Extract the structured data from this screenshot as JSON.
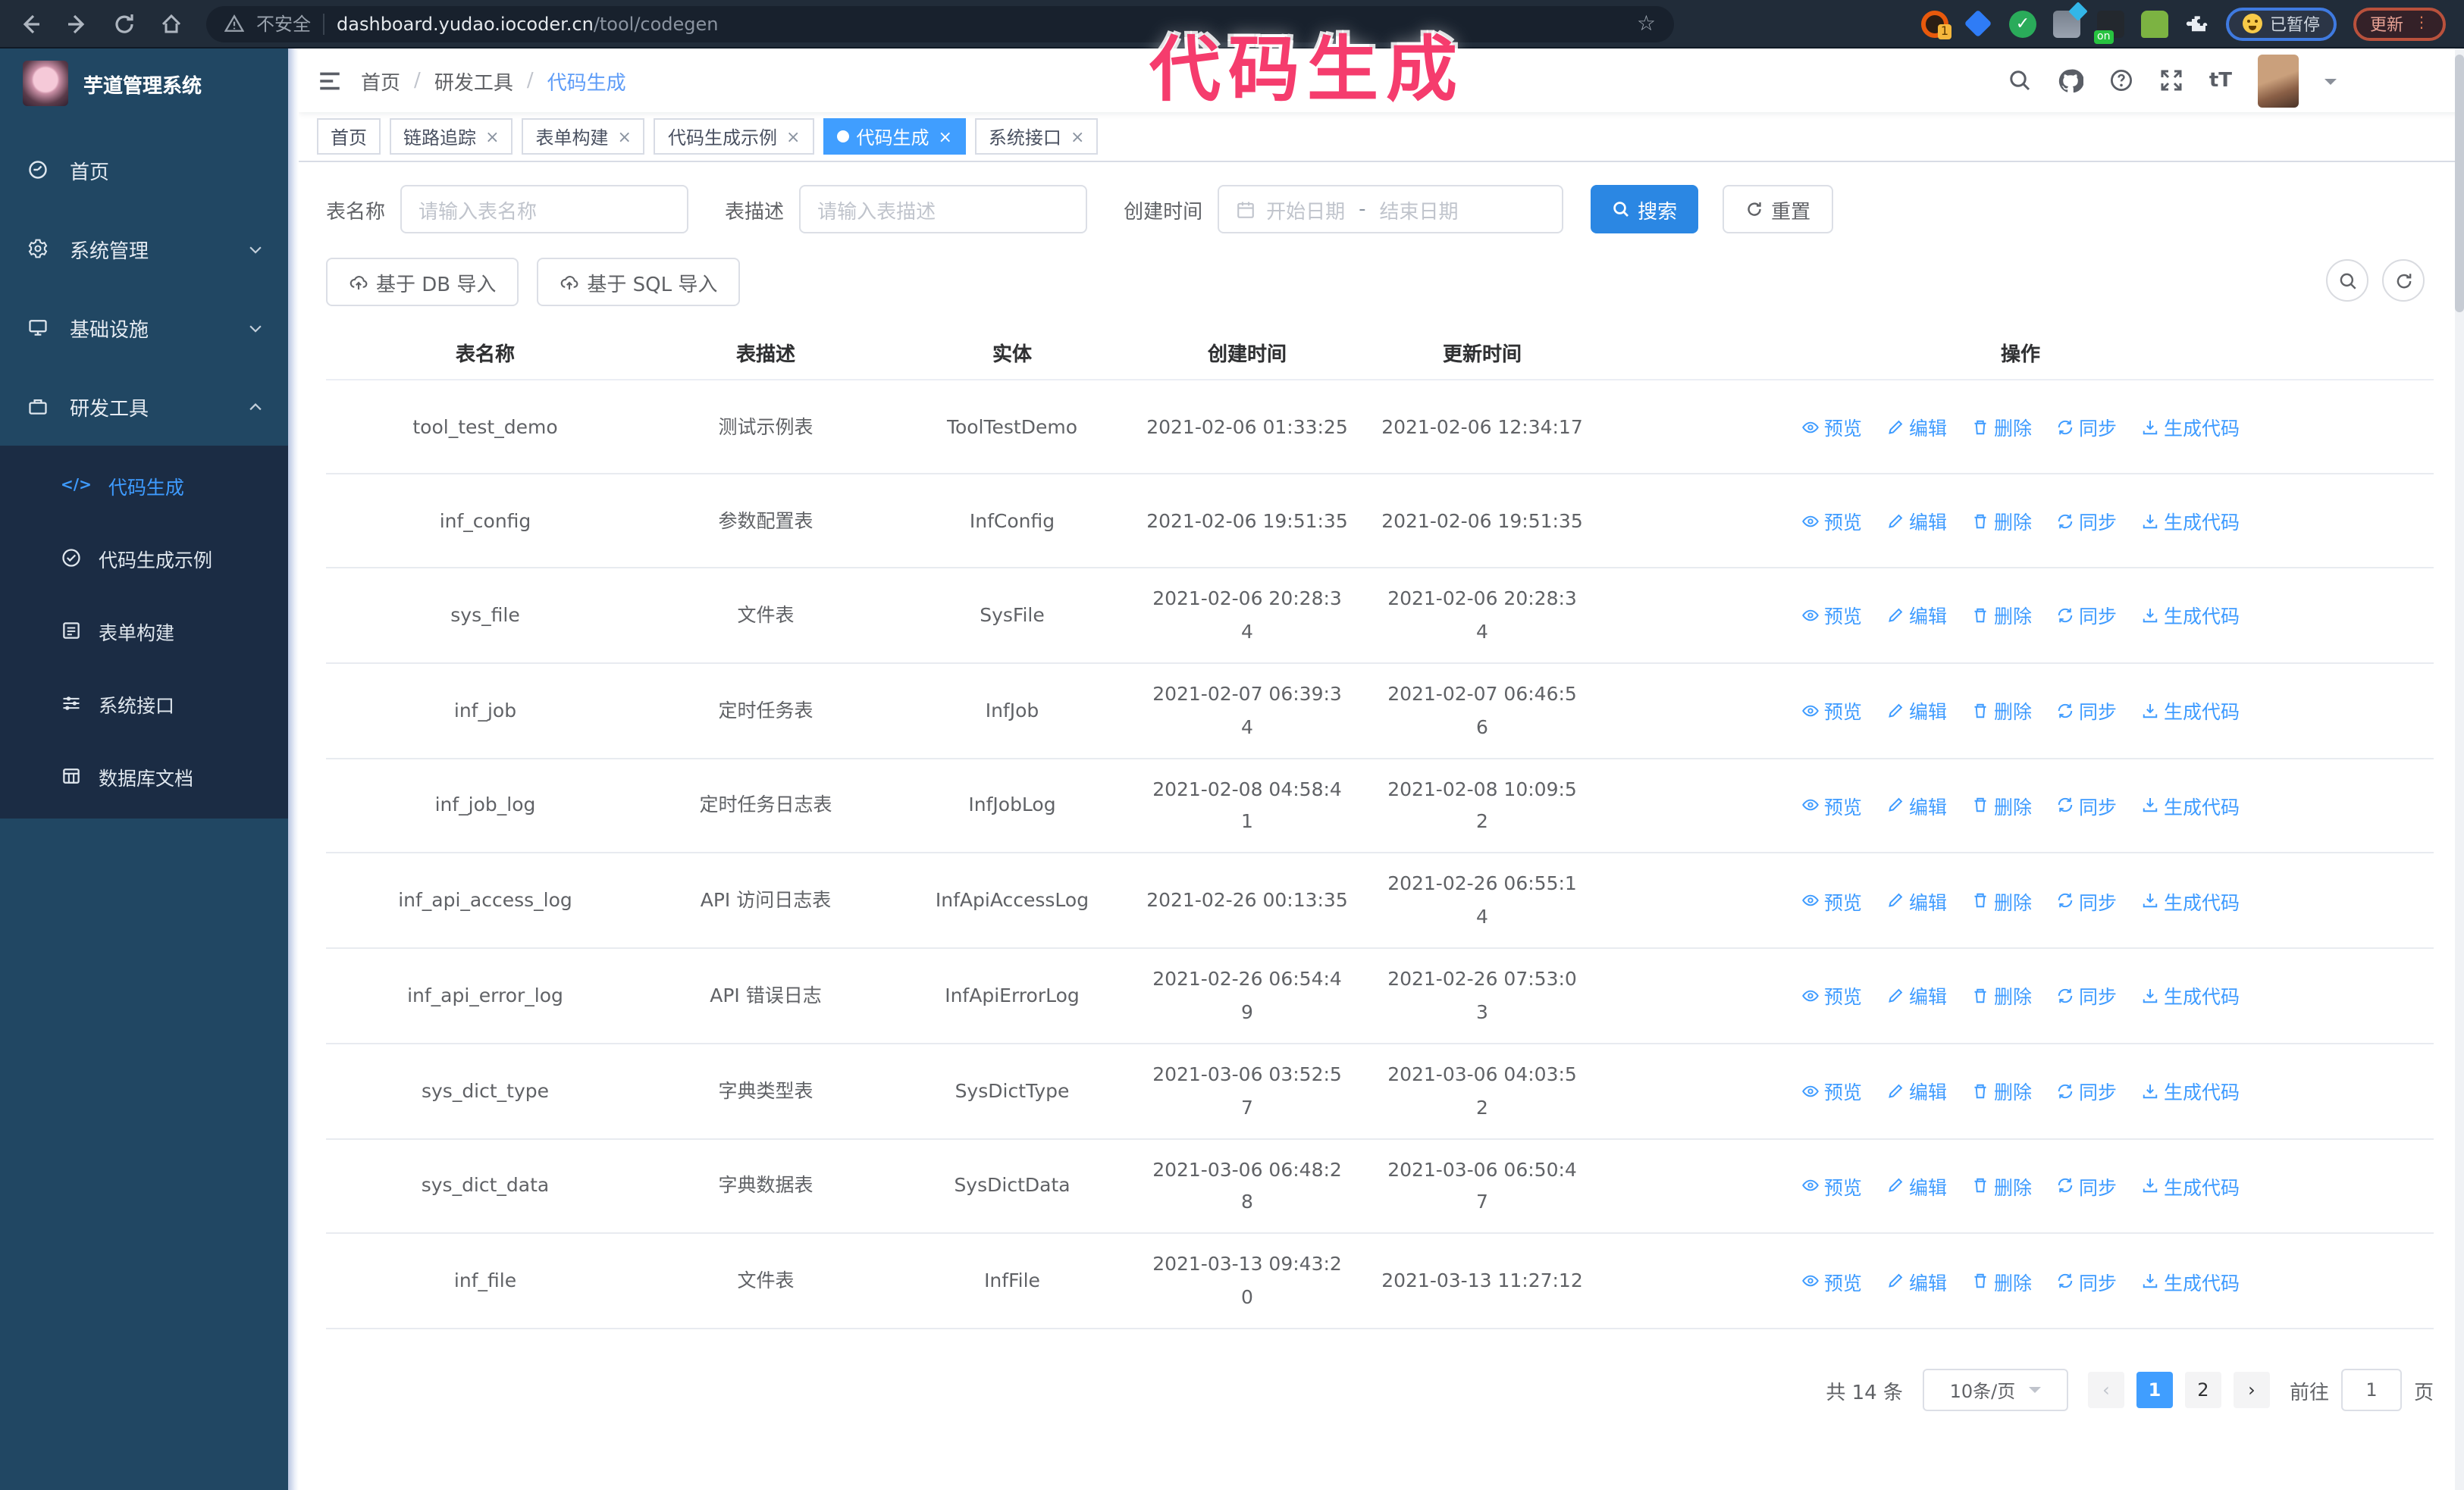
{
  "annotation": {
    "text": "代码生成",
    "color": "#f53c6d"
  },
  "browser": {
    "security_label": "不安全",
    "url_host": "dashboard.yudao.iocoder.cn",
    "url_path": "/tool/codegen",
    "extension_badge": "1",
    "on_badge": "on",
    "check_glyph": "✓",
    "paused_label": "已暂停",
    "update_label": "更新",
    "menu_dots": "⋮",
    "star_glyph": "☆"
  },
  "sidebar": {
    "title": "芋道管理系统",
    "menu": [
      {
        "label": "首页"
      },
      {
        "label": "系统管理"
      },
      {
        "label": "基础设施"
      },
      {
        "label": "研发工具"
      }
    ],
    "submenu": [
      {
        "label": "代码生成",
        "active": true
      },
      {
        "label": "代码生成示例"
      },
      {
        "label": "表单构建"
      },
      {
        "label": "系统接口"
      },
      {
        "label": "数据库文档"
      }
    ],
    "code_glyph": "</>"
  },
  "header": {
    "breadcrumb": {
      "home": "首页",
      "group": "研发工具",
      "current": "代码生成",
      "separator": "/"
    },
    "text_size_glyph": "tT"
  },
  "tabs": [
    {
      "label": "首页"
    },
    {
      "label": "链路追踪"
    },
    {
      "label": "表单构建"
    },
    {
      "label": "代码生成示例"
    },
    {
      "label": "代码生成",
      "active": true
    },
    {
      "label": "系统接口"
    }
  ],
  "tab_close_glyph": "×",
  "filters": {
    "name_label": "表名称",
    "name_placeholder": "请输入表名称",
    "desc_label": "表描述",
    "desc_placeholder": "请输入表描述",
    "time_label": "创建时间",
    "start_placeholder": "开始日期",
    "range_separator": "-",
    "end_placeholder": "结束日期",
    "search_label": "搜索",
    "reset_label": "重置",
    "import_db_label": "基于 DB 导入",
    "import_sql_label": "基于 SQL 导入"
  },
  "table": {
    "columns": [
      "表名称",
      "表描述",
      "实体",
      "创建时间",
      "更新时间",
      "操作"
    ],
    "actions": [
      {
        "label": "预览",
        "icon": "eye-icon"
      },
      {
        "label": "编辑",
        "icon": "edit-icon"
      },
      {
        "label": "删除",
        "icon": "delete-icon"
      },
      {
        "label": "同步",
        "icon": "sync-icon"
      },
      {
        "label": "生成代码",
        "icon": "download-icon"
      }
    ],
    "rows": [
      {
        "name": "tool_test_demo",
        "desc": "测试示例表",
        "entity": "ToolTestDemo",
        "created": "2021-02-06 01:33:25",
        "updated": "2021-02-06 12:34:17"
      },
      {
        "name": "inf_config",
        "desc": "参数配置表",
        "entity": "InfConfig",
        "created": "2021-02-06 19:51:35",
        "updated": "2021-02-06 19:51:35"
      },
      {
        "name": "sys_file",
        "desc": "文件表",
        "entity": "SysFile",
        "created": "2021-02-06 20:28:3\n4",
        "updated": "2021-02-06 20:28:3\n4"
      },
      {
        "name": "inf_job",
        "desc": "定时任务表",
        "entity": "InfJob",
        "created": "2021-02-07 06:39:3\n4",
        "updated": "2021-02-07 06:46:5\n6"
      },
      {
        "name": "inf_job_log",
        "desc": "定时任务日志表",
        "entity": "InfJobLog",
        "created": "2021-02-08 04:58:4\n1",
        "updated": "2021-02-08 10:09:5\n2"
      },
      {
        "name": "inf_api_access_log",
        "desc": "API 访问日志表",
        "entity": "InfApiAccessLog",
        "created": "2021-02-26 00:13:35",
        "updated": "2021-02-26 06:55:1\n4"
      },
      {
        "name": "inf_api_error_log",
        "desc": "API 错误日志",
        "entity": "InfApiErrorLog",
        "created": "2021-02-26 06:54:4\n9",
        "updated": "2021-02-26 07:53:0\n3"
      },
      {
        "name": "sys_dict_type",
        "desc": "字典类型表",
        "entity": "SysDictType",
        "created": "2021-03-06 03:52:5\n7",
        "updated": "2021-03-06 04:03:5\n2"
      },
      {
        "name": "sys_dict_data",
        "desc": "字典数据表",
        "entity": "SysDictData",
        "created": "2021-03-06 06:48:2\n8",
        "updated": "2021-03-06 06:50:4\n7"
      },
      {
        "name": "inf_file",
        "desc": "文件表",
        "entity": "InfFile",
        "created": "2021-03-13 09:43:2\n0",
        "updated": "2021-03-13 11:27:12"
      }
    ]
  },
  "pagination": {
    "total_label": "共 14 条",
    "page_size": "10条/页",
    "prev_glyph": "‹",
    "next_glyph": "›",
    "pages": [
      "1",
      "2"
    ],
    "goto_label": "前往",
    "goto_value": "1",
    "page_unit": "页"
  },
  "colors": {
    "accent": "#409eff",
    "button_blue": "#2b87e3",
    "sidebar_bg": "#214763",
    "submenu_bg": "#1b2c44",
    "annotation_pink": "#f53c6d"
  }
}
